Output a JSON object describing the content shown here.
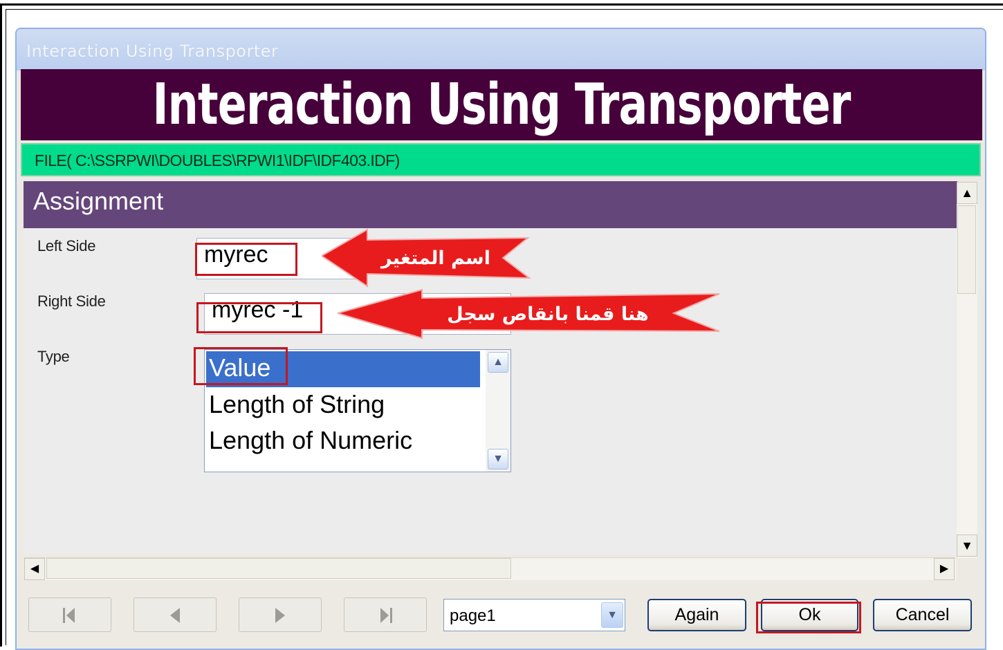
{
  "window": {
    "title": "Interaction Using Transporter",
    "banner_title": "Interaction Using Transporter",
    "file_path": "FILE( C:\\SSRPWI\\DOUBLES\\RPWI1\\IDF\\IDF403.IDF)"
  },
  "panel": {
    "title": "Assignment",
    "left_side_label": "Left Side",
    "left_side_value": "myrec",
    "right_side_label": "Right Side",
    "right_side_value": "myrec -1",
    "type_label": "Type",
    "type_options": [
      "Value",
      "Length of String",
      "Length of Numeric"
    ],
    "type_selected": "Value"
  },
  "annotations": {
    "left_side_note": "اسم المتغير",
    "right_side_note": "هنا قمنا بانقاص سجل"
  },
  "footer": {
    "page_select_value": "page1",
    "again_label": "Again",
    "ok_label": "Ok",
    "cancel_label": "Cancel"
  },
  "colors": {
    "banner": "#46003a",
    "file_bar": "#00dc8c",
    "panel_header": "#65467a",
    "highlight_box": "#c4171f",
    "annotation_arrow": "#e81c1c"
  }
}
